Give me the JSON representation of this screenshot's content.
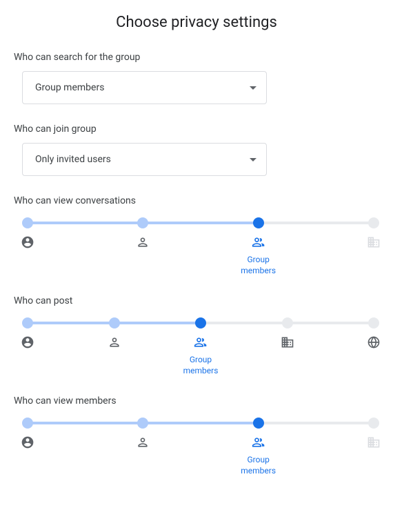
{
  "title": "Choose privacy settings",
  "colors": {
    "accent": "#1a73e8",
    "accentLight": "#aecbfa",
    "grey": "#5f6368",
    "light": "#dadce0"
  },
  "sections": {
    "search": {
      "label": "Who can search for the group",
      "dropdown": {
        "value": "Group members"
      }
    },
    "join": {
      "label": "Who can join group",
      "dropdown": {
        "value": "Only invited users"
      }
    },
    "viewConversations": {
      "label": "Who can view conversations",
      "selectedLabel": "Group\nmembers",
      "options": [
        {
          "key": "owners",
          "icon": "account-circle",
          "state": "left"
        },
        {
          "key": "managers",
          "icon": "person",
          "state": "left"
        },
        {
          "key": "members",
          "icon": "group",
          "state": "selected",
          "label": "Group\nmembers"
        },
        {
          "key": "org",
          "icon": "domain",
          "state": "right-light"
        }
      ]
    },
    "post": {
      "label": "Who can post",
      "options": [
        {
          "key": "owners",
          "icon": "account-circle",
          "state": "left"
        },
        {
          "key": "managers",
          "icon": "person",
          "state": "left"
        },
        {
          "key": "members",
          "icon": "group",
          "state": "selected",
          "label": "Group\nmembers"
        },
        {
          "key": "org",
          "icon": "domain",
          "state": "right"
        },
        {
          "key": "web",
          "icon": "public",
          "state": "right"
        }
      ]
    },
    "viewMembers": {
      "label": "Who can view members",
      "options": [
        {
          "key": "owners",
          "icon": "account-circle",
          "state": "left"
        },
        {
          "key": "managers",
          "icon": "person",
          "state": "left"
        },
        {
          "key": "members",
          "icon": "group",
          "state": "selected",
          "label": "Group\nmembers"
        },
        {
          "key": "org",
          "icon": "domain",
          "state": "right-light"
        }
      ]
    }
  }
}
